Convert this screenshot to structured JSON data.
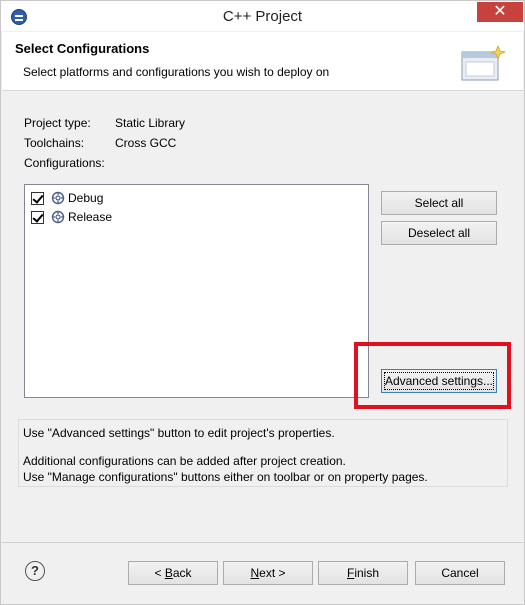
{
  "window": {
    "title": "C++ Project",
    "close_glyph": "✕"
  },
  "header": {
    "title": "Select Configurations",
    "description": "Select platforms and configurations you wish to deploy on"
  },
  "project_info": {
    "project_type_label": "Project type:",
    "project_type_value": "Static Library",
    "toolchains_label": "Toolchains:",
    "toolchains_value": "Cross GCC",
    "configurations_label": "Configurations:"
  },
  "configurations": [
    {
      "label": "Debug",
      "checked": true
    },
    {
      "label": "Release",
      "checked": true
    }
  ],
  "side_buttons": {
    "select_all": "Select all",
    "deselect_all": "Deselect all",
    "advanced_settings": "Advanced settings..."
  },
  "messages": {
    "line1": "Use \"Advanced settings\" button to edit project's properties.",
    "line2": "Additional configurations can be added after project creation.",
    "line3": "Use \"Manage configurations\" buttons either on toolbar or on property pages."
  },
  "footer": {
    "help_glyph": "?",
    "back_mnemonic": "B",
    "back_rest": "ack",
    "back_prefix": "< ",
    "next_mnemonic": "N",
    "next_rest": "ext >",
    "finish_mnemonic": "F",
    "finish_rest": "inish",
    "cancel": "Cancel"
  },
  "colors": {
    "highlight": "#e1101f",
    "close_button": "#c7413e"
  },
  "icons": {
    "app": "eclipse-icon",
    "wizard": "wizard-banner-icon",
    "configuration": "configuration-gear-icon",
    "help": "help-icon"
  }
}
